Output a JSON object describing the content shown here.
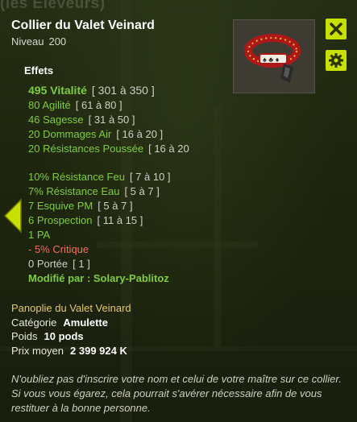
{
  "watermark": "(les Eleveurs)",
  "item": {
    "name": "Collier du Valet Veinard",
    "level_label": "Niveau",
    "level_value": "200"
  },
  "buttons": {
    "close_icon": "close-icon",
    "settings_icon": "gear-icon",
    "prev_icon": "chevron-left-icon"
  },
  "effects_heading": "Effets",
  "effects": [
    {
      "text": "495 Vitalité",
      "range": "[ 301 à 350 ]",
      "color": "green"
    },
    {
      "text": "80 Agilité",
      "range": "[ 61 à 80 ]",
      "color": "green"
    },
    {
      "text": "46 Sagesse",
      "range": "[ 31 à 50 ]",
      "color": "green"
    },
    {
      "text": "20 Dommages Air",
      "range": "[ 16 à 20 ]",
      "color": "green"
    },
    {
      "text": "20 Résistances Poussée",
      "range": "[ 16 à 20",
      "color": "green"
    },
    {
      "text": "10% Résistance Feu",
      "range": "[ 7 à 10 ]",
      "color": "green"
    },
    {
      "text": "7% Résistance Eau",
      "range": "[ 5 à 7 ]",
      "color": "green"
    },
    {
      "text": "7 Esquive PM",
      "range": "[ 5 à 7 ]",
      "color": "green"
    },
    {
      "text": "6 Prospection",
      "range": "[ 11 à 15 ]",
      "color": "green"
    },
    {
      "text": "1 PA",
      "range": "",
      "color": "green"
    },
    {
      "text": "- 5% Critique",
      "range": "",
      "color": "red"
    },
    {
      "text": "0 Portée",
      "range": "[ 1 ]",
      "color": "gray"
    },
    {
      "text": "Modifié par : Solary-Pablitoz",
      "range": "",
      "color": "green"
    }
  ],
  "set_name": "Panoplie du Valet Veinard",
  "details": {
    "category_label": "Catégorie",
    "category_value": "Amulette",
    "weight_label": "Poids",
    "weight_value": "10 pods",
    "price_label": "Prix moyen",
    "price_value": "2 399 924 K"
  },
  "description": "N'oubliez pas d'inscrire votre nom et celui de votre maître sur ce collier. Si vous vous égarez, cela pourrait s'avérer nécessaire afin de vous restituer à la bonne personne.",
  "colors": {
    "accent": "#c8e000",
    "green": "#7fcd3a",
    "red": "#f07060",
    "gold": "#e4c86a"
  }
}
